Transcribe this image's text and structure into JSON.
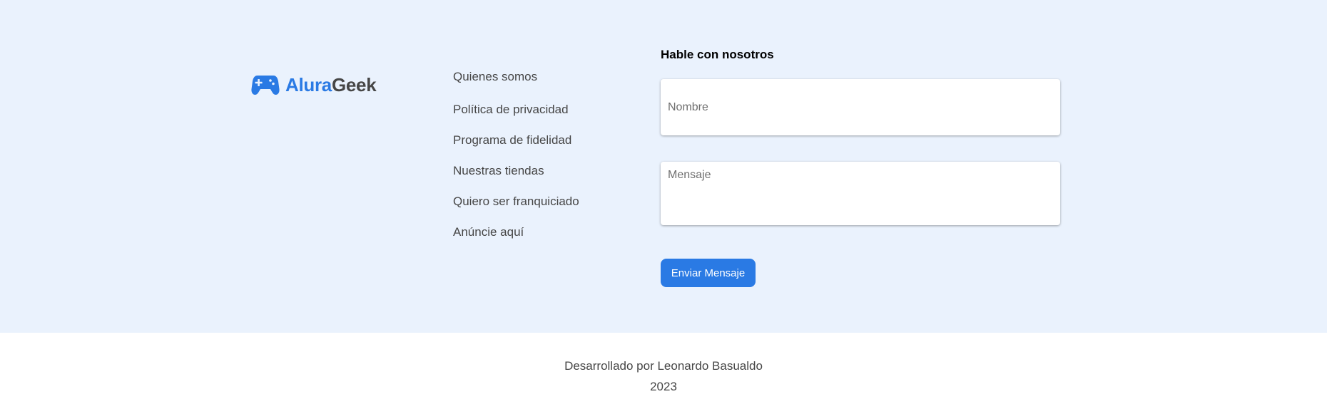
{
  "logo": {
    "icon": "gamepad-icon",
    "text_primary": "Alura",
    "text_secondary": "Geek",
    "color_primary": "#2a7ae4",
    "color_secondary": "#464646"
  },
  "links": [
    {
      "label": "Quienes somos"
    },
    {
      "label": "Política de privacidad"
    },
    {
      "label": "Programa de fidelidad"
    },
    {
      "label": "Nuestras tiendas"
    },
    {
      "label": "Quiero ser franquiciado"
    },
    {
      "label": "Anúncie aquí"
    }
  ],
  "contact": {
    "title": "Hable con nosotros",
    "name_placeholder": "Nombre",
    "name_value": "",
    "message_placeholder": "Mensaje",
    "message_value": "",
    "send_label": "Enviar Mensaje"
  },
  "footer": {
    "credit": "Desarrollado por Leonardo Basualdo",
    "year": "2023"
  },
  "colors": {
    "accent": "#2a7ae4",
    "footer_background": "#eaf2fd",
    "text": "#464646"
  }
}
